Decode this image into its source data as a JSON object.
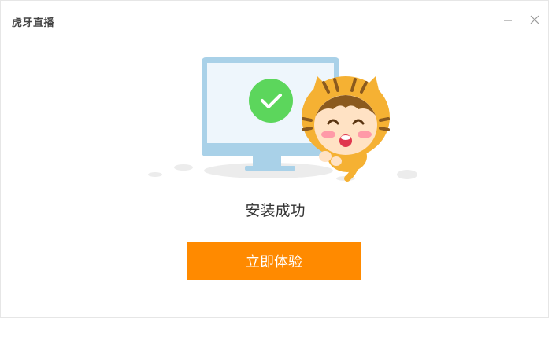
{
  "window": {
    "title": "虎牙直播",
    "minimize_icon": "minimize-icon",
    "close_icon": "close-icon"
  },
  "illustration": {
    "icons": [
      "monitor-icon",
      "checkmark-icon",
      "tiger-mascot"
    ],
    "check_color": "#5cd65c",
    "monitor_color": "#a9d1e8"
  },
  "status": {
    "message": "安装成功"
  },
  "action": {
    "button_label": "立即体验",
    "button_color": "#ff8a00"
  }
}
